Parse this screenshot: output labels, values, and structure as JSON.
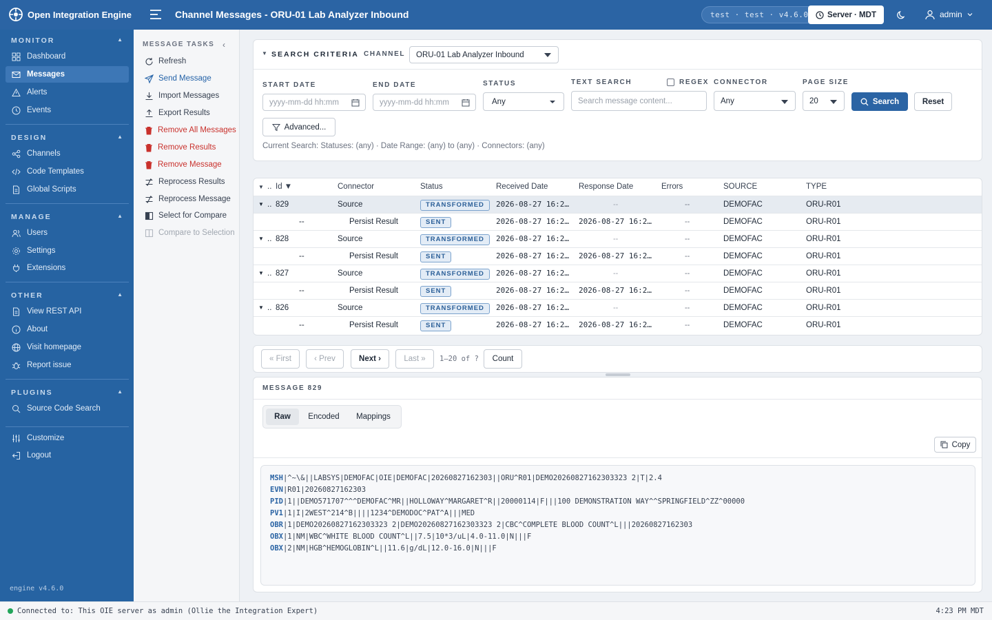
{
  "app": {
    "name": "Open Integration Engine",
    "title": "Channel Messages - ORU-01 Lab Analyzer Inbound",
    "env": "test · test · v4.6.0",
    "server": "Server · MDT",
    "user": "admin",
    "version": "engine v4.6.0"
  },
  "sidebar": {
    "monitor": {
      "title": "MONITOR",
      "items": [
        "Dashboard",
        "Messages",
        "Alerts",
        "Events"
      ]
    },
    "design": {
      "title": "DESIGN",
      "items": [
        "Channels",
        "Code Templates",
        "Global Scripts"
      ]
    },
    "manage": {
      "title": "MANAGE",
      "items": [
        "Users",
        "Settings",
        "Extensions"
      ]
    },
    "other": {
      "title": "OTHER",
      "items": [
        "View REST API",
        "About",
        "Visit homepage",
        "Report issue"
      ]
    },
    "plugins": {
      "title": "PLUGINS",
      "items": [
        "Source Code Search"
      ]
    },
    "bottom": [
      "Customize",
      "Logout"
    ]
  },
  "tasks": {
    "title": "MESSAGE TASKS",
    "items": [
      "Refresh",
      "Send Message",
      "Import Messages",
      "Export Results",
      "Remove All Messages",
      "Remove Results",
      "Remove Message",
      "Reprocess Results",
      "Reprocess Message",
      "Select for Compare",
      "Compare to Selection"
    ]
  },
  "search": {
    "title": "SEARCH CRITERIA",
    "channel_label": "CHANNEL",
    "channel": "ORU-01 Lab Analyzer Inbound",
    "start_label": "START DATE",
    "end_label": "END DATE",
    "date_placeholder": "yyyy-mm-dd hh:mm",
    "status_label": "STATUS",
    "status": "Any",
    "text_label": "TEXT SEARCH",
    "text_placeholder": "Search message content...",
    "regex_label": "REGEX",
    "connector_label": "CONNECTOR",
    "connector": "Any",
    "pagesize_label": "PAGE SIZE",
    "pagesize": "20",
    "search_btn": "Search",
    "reset_btn": "Reset",
    "advanced_btn": "Advanced...",
    "current": "Current Search: Statuses: (any) · Date Range: (any) to (any) · Connectors: (any)"
  },
  "table": {
    "headers": [
      "..",
      "Id",
      "Connector",
      "Status",
      "Received Date",
      "Response Date",
      "Errors",
      "SOURCE",
      "TYPE"
    ],
    "rows": [
      {
        "dots": "..",
        "id": "829",
        "connector": "Source",
        "status": "TRANSFORMED",
        "received": "2026-08-27 16:2…",
        "response": "--",
        "errors": "--",
        "source": "DEMOFAC",
        "type": "ORU-R01"
      },
      {
        "dots": "",
        "id": "--",
        "connector": "Persist Result",
        "status": "SENT",
        "received": "2026-08-27 16:2…",
        "response": "2026-08-27 16:2…",
        "errors": "--",
        "source": "DEMOFAC",
        "type": "ORU-R01"
      },
      {
        "dots": "..",
        "id": "828",
        "connector": "Source",
        "status": "TRANSFORMED",
        "received": "2026-08-27 16:2…",
        "response": "--",
        "errors": "--",
        "source": "DEMOFAC",
        "type": "ORU-R01"
      },
      {
        "dots": "",
        "id": "--",
        "connector": "Persist Result",
        "status": "SENT",
        "received": "2026-08-27 16:2…",
        "response": "2026-08-27 16:2…",
        "errors": "--",
        "source": "DEMOFAC",
        "type": "ORU-R01"
      },
      {
        "dots": "..",
        "id": "827",
        "connector": "Source",
        "status": "TRANSFORMED",
        "received": "2026-08-27 16:2…",
        "response": "--",
        "errors": "--",
        "source": "DEMOFAC",
        "type": "ORU-R01"
      },
      {
        "dots": "",
        "id": "--",
        "connector": "Persist Result",
        "status": "SENT",
        "received": "2026-08-27 16:2…",
        "response": "2026-08-27 16:2…",
        "errors": "--",
        "source": "DEMOFAC",
        "type": "ORU-R01"
      },
      {
        "dots": "..",
        "id": "826",
        "connector": "Source",
        "status": "TRANSFORMED",
        "received": "2026-08-27 16:2…",
        "response": "--",
        "errors": "--",
        "source": "DEMOFAC",
        "type": "ORU-R01"
      },
      {
        "dots": "",
        "id": "--",
        "connector": "Persist Result",
        "status": "SENT",
        "received": "2026-08-27 16:2…",
        "response": "2026-08-27 16:2…",
        "errors": "--",
        "source": "DEMOFAC",
        "type": "ORU-R01"
      }
    ]
  },
  "pager": {
    "first": "« First",
    "prev": "‹ Prev",
    "next": "Next ›",
    "last": "Last »",
    "range": "1–20 of ?",
    "count": "Count"
  },
  "message": {
    "title": "MESSAGE 829",
    "tabs": [
      "Raw",
      "Encoded",
      "Mappings"
    ],
    "copy": "Copy",
    "segments": [
      {
        "id": "MSH",
        "rest": "|^~\\&||LABSYS|DEMOFAC|OIE|DEMOFAC|20260827162303||ORU^R01|DEMO20260827162303323 2|T|2.4"
      },
      {
        "id": "EVN",
        "rest": "|R01|20260827162303"
      },
      {
        "id": "PID",
        "rest": "|1||DEMO571707^^^DEMOFAC^MR||HOLLOWAY^MARGARET^R||20000114|F|||100 DEMONSTRATION WAY^^SPRINGFIELD^ZZ^00000"
      },
      {
        "id": "PV1",
        "rest": "|1|I|2WEST^214^B||||1234^DEMODOC^PAT^A|||MED"
      },
      {
        "id": "OBR",
        "rest": "|1|DEMO20260827162303323 2|DEMO20260827162303323 2|CBC^COMPLETE BLOOD COUNT^L|||20260827162303"
      },
      {
        "id": "OBX",
        "rest": "|1|NM|WBC^WHITE BLOOD COUNT^L||7.5|10*3/uL|4.0-11.0|N|||F"
      },
      {
        "id": "OBX",
        "rest": "|2|NM|HGB^HEMOGLOBIN^L||11.6|g/dL|12.0-16.0|N|||F"
      }
    ]
  },
  "statusbar": {
    "text": "Connected to: This OIE server as admin (Ollie the Integration Expert)",
    "time": "4:23 PM MDT"
  }
}
